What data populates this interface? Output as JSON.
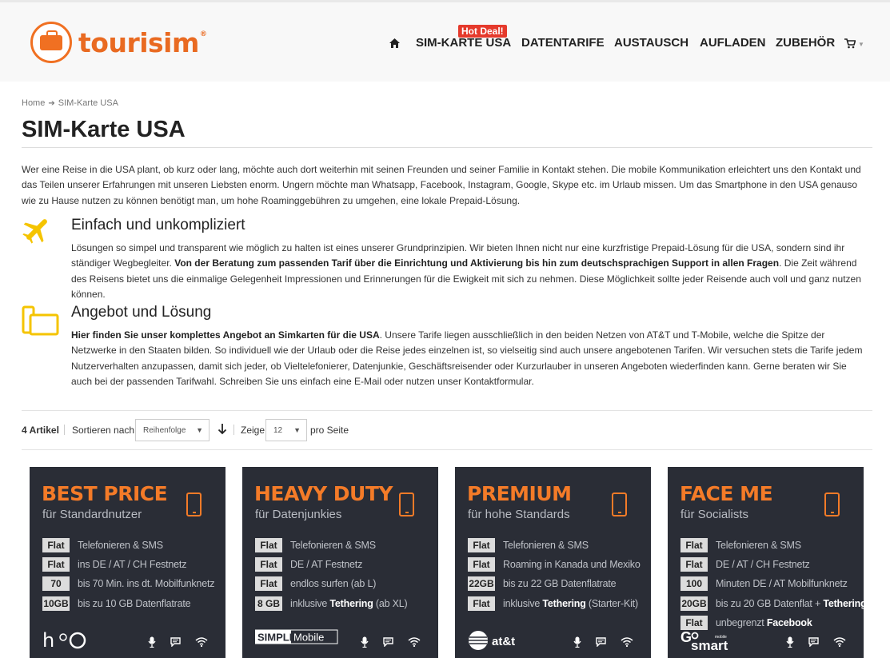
{
  "header": {
    "logo_text": "tourisim",
    "logo_reg": "®",
    "nav": {
      "hot_deal": "Hot Deal!",
      "items": [
        "SIM-KARTE USA",
        "DATENTARIFE",
        "AUSTAUSCH",
        "AUFLADEN",
        "ZUBEHÖR"
      ]
    }
  },
  "breadcrumb": {
    "home": "Home",
    "current": "SIM-Karte USA"
  },
  "page_title": "SIM-Karte USA",
  "intro": "Wer eine Reise in die USA plant, ob kurz oder lang, möchte auch dort weiterhin mit seinen Freunden und seiner Familie in Kontakt stehen. Die mobile Kommunikation erleichtert uns den Kontakt und das Teilen unserer Erfahrungen mit unseren Liebsten enorm. Ungern möchte man Whatsapp, Facebook, Instagram, Google, Skype etc. im Urlaub missen. Um das Smartphone in den USA genauso wie zu Hause nutzen zu können benötigt man, um hohe Roaminggebühren zu umgehen, eine lokale Prepaid-Lösung.",
  "features": [
    {
      "title": "Einfach und unkompliziert",
      "text_1": "Lösungen so simpel und transparent wie möglich zu halten ist eines unserer Grundprinzipien. Wir bieten Ihnen nicht nur eine kurzfristige Prepaid-Lösung für die USA, sondern sind ihr ständiger Wegbegleiter. ",
      "text_bold": "Von der Beratung zum passenden Tarif über die Einrichtung und Aktivierung bis hin zum deutschsprachigen Support in allen Fragen",
      "text_2": ". Die Zeit während des Reisens bietet uns die einmalige Gelegenheit Impressionen und Erinnerungen für die Ewigkeit mit sich zu nehmen. Diese Möglichkeit sollte jeder Reisende auch voll und ganz nutzen können."
    },
    {
      "title": "Angebot und Lösung",
      "text_bold": "Hier finden Sie unser komplettes Angebot an Simkarten für die USA",
      "text_2": ". Unsere Tarife liegen ausschließlich in den beiden Netzen von AT&T und T-Mobile, welche die Spitze der Netzwerke in den Staaten bilden. So individuell wie der Urlaub oder die Reise jedes einzelnen ist, so vielseitig sind auch unsere angebotenen Tarifen. Wir versuchen stets die Tarife jedem Nutzerverhalten anzupassen, damit sich jeder, ob Vieltelefonierer, Datenjunkie, Geschäftsreisender oder Kurzurlauber in unseren Angeboten wiederfinden kann. Gerne beraten wir Sie auch bei der passenden Tarifwahl. Schreiben Sie uns einfach eine E-Mail oder nutzen unser Kontaktformular."
    }
  ],
  "toolbar": {
    "count": "4 Artikel",
    "sort_label": "Sortieren nach",
    "sort_value": "Reihenfolge",
    "show_label": "Zeige",
    "show_value": "12",
    "per_page": "pro Seite"
  },
  "products": [
    {
      "title": "BEST PRICE",
      "subtitle": "für Standardnutzer",
      "brand": "h2o",
      "rows": [
        {
          "badge": "Flat",
          "text": "Telefonieren & SMS"
        },
        {
          "badge": "Flat",
          "text": "ins DE / AT / CH Festnetz"
        },
        {
          "badge": "70",
          "text": "bis 70 Min. ins dt. Mobilfunknetz"
        },
        {
          "badge": "10GB",
          "text": "bis zu 10 GB Datenflatrate"
        }
      ]
    },
    {
      "title": "HEAVY DUTY",
      "subtitle": "für Datenjunkies",
      "brand": "SIMPLE Mobile",
      "rows": [
        {
          "badge": "Flat",
          "text": "Telefonieren & SMS"
        },
        {
          "badge": "Flat",
          "text": "DE / AT Festnetz"
        },
        {
          "badge": "Flat",
          "text": "endlos surfen (ab L)"
        },
        {
          "badge": "8 GB",
          "text": "inklusive ",
          "bold": "Tethering",
          "after": " (ab XL)"
        }
      ]
    },
    {
      "title": "PREMIUM",
      "subtitle": "für hohe Standards",
      "brand": "at&t",
      "rows": [
        {
          "badge": "Flat",
          "text": "Telefonieren & SMS"
        },
        {
          "badge": "Flat",
          "text": "Roaming in Kanada und Mexiko"
        },
        {
          "badge": "22GB",
          "text": "bis zu 22 GB Datenflatrate"
        },
        {
          "badge": "Flat",
          "text": "inklusive ",
          "bold": "Tethering",
          "after": " (Starter-Kit)"
        }
      ]
    },
    {
      "title": "FACE ME",
      "subtitle": "für Socialists",
      "brand": "GoSmart",
      "rows": [
        {
          "badge": "Flat",
          "text": "Telefonieren & SMS"
        },
        {
          "badge": "Flat",
          "text": "DE / AT / CH  Festnetz"
        },
        {
          "badge": "100",
          "text": "Minuten DE / AT Mobilfunknetz"
        },
        {
          "badge": "20GB",
          "text": "bis zu 20 GB Datenflat + ",
          "bold": "Tethering",
          "after": ""
        },
        {
          "badge": "Flat",
          "text": "unbegrenzt ",
          "bold": "Facebook",
          "after": ""
        }
      ]
    }
  ],
  "colors": {
    "brand_orange": "#f07022",
    "hot_red": "#e53a2c",
    "card_bg": "#2a2d36",
    "icon_yellow": "#f5c400"
  }
}
